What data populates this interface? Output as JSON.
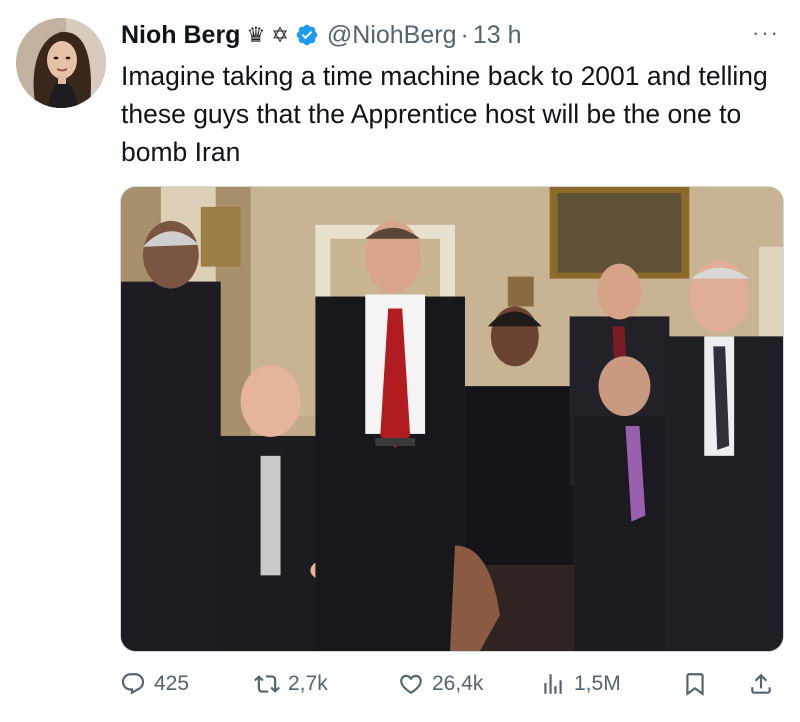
{
  "author": {
    "display_name": "Nioh Berg",
    "badges": [
      "♛",
      "✡"
    ],
    "verified": true,
    "handle": "@NiohBerg",
    "separator": "·",
    "timestamp": "13 h",
    "avatar_icon": "profile-photo"
  },
  "tweet": {
    "text": "Imagine taking a time machine back to 2001 and telling these guys that the Apprentice host will be the one to bomb Iran",
    "more_icon": "more-horizontal-icon",
    "more_glyph": "···"
  },
  "media": {
    "type": "photo"
  },
  "actions": {
    "replies": {
      "icon": "reply-icon",
      "count": "425"
    },
    "retweets": {
      "icon": "retweet-icon",
      "count": "2,7k"
    },
    "likes": {
      "icon": "like-icon",
      "count": "26,4k"
    },
    "views": {
      "icon": "views-icon",
      "count": "1,5M"
    },
    "bookmark": {
      "icon": "bookmark-icon"
    },
    "share": {
      "icon": "share-icon"
    }
  },
  "colors": {
    "primary_text": "#0f1419",
    "secondary_text": "#536471",
    "verified_blue": "#1d9bf0",
    "background": "#ffffff"
  }
}
